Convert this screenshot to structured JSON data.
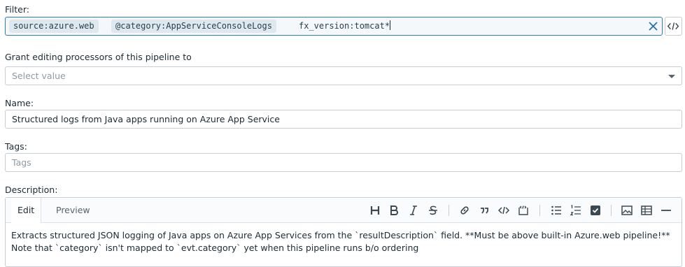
{
  "filter": {
    "label": "Filter:",
    "chips": [
      "source:azure.web",
      "@category:AppServiceConsoleLogs",
      "fx_version:tomcat*"
    ]
  },
  "grant": {
    "label": "Grant editing processors of this pipeline to",
    "placeholder": "Select value"
  },
  "name": {
    "label": "Name:",
    "value": "Structured logs from Java apps running on Azure App Service"
  },
  "tags": {
    "label": "Tags:",
    "placeholder": "Tags"
  },
  "description": {
    "label": "Description:",
    "tabs": {
      "edit": "Edit",
      "preview": "Preview"
    },
    "lines": [
      "Extracts structured JSON logging of Java apps on Azure App Services from the `resultDescription` field. **Must be above built-in Azure.web pipeline!**",
      "Note that  `category` isn't mapped to `evt.category` yet when this pipeline runs b/o ordering"
    ]
  },
  "colors": {
    "accent": "#2a7fb8",
    "border": "#c7cdd2",
    "chip": "#dfe8ef"
  }
}
